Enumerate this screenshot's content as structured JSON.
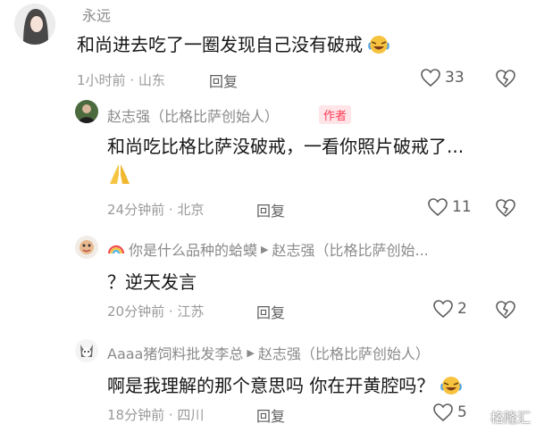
{
  "comments": [
    {
      "username": "永远",
      "text": "和尚进去吃了一圈发现自己没有破戒",
      "time_location": "1小时前 · 山东",
      "reply_label": "回复",
      "likes": "33"
    },
    {
      "username": "赵志强（比格比萨创始人）",
      "badge": "作者",
      "text": "和尚吃比格比萨没破戒，一看你照片破戒了...",
      "time_location": "24分钟前 · 北京",
      "reply_label": "回复",
      "likes": "11"
    },
    {
      "username": "你是什么品种的蛤蟆",
      "reply_to": "赵志强（比格比萨创始...",
      "text": "？逆天发言",
      "time_location": "20分钟前 · 江苏",
      "reply_label": "回复",
      "likes": "2"
    },
    {
      "username": "Aaaa猪饲料批发李总",
      "reply_to": "赵志强（比格比萨创始人）",
      "text": "啊是我理解的那个意思吗 你在开黄腔吗？",
      "time_location": "18分钟前 · 四川",
      "reply_label": "回复",
      "likes": "5"
    }
  ],
  "watermark": "格隆汇",
  "colors": {
    "text": "#161616",
    "muted": "#9a9a9a",
    "badge_bg": "#ffe4e8",
    "badge_fg": "#ff3a54"
  }
}
